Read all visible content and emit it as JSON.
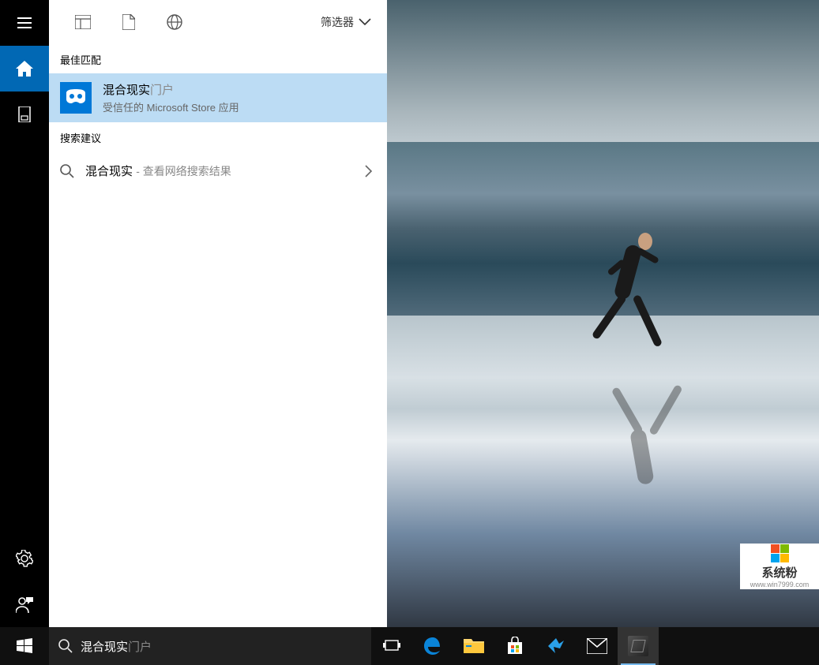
{
  "cortana": {
    "top": {
      "filter_label": "筛选器",
      "icons": [
        "apps-icon",
        "document-icon",
        "web-icon"
      ]
    },
    "sections": {
      "best_match": "最佳匹配",
      "suggestions": "搜索建议"
    },
    "best_result": {
      "title_match": "混合现实",
      "title_suffix": "门户",
      "subtitle": "受信任的 Microsoft Store 应用",
      "icon": "mixed-reality-portal-icon"
    },
    "suggestion": {
      "text": "混合现实",
      "extra": "查看网络搜索结果"
    },
    "rail": {
      "items": [
        "menu",
        "home",
        "notebook"
      ],
      "bottom_items": [
        "settings",
        "feedback"
      ]
    }
  },
  "search": {
    "typed": "混合现实",
    "completion": "门户"
  },
  "taskbar": {
    "pinned": [
      "task-view",
      "edge",
      "file-explorer",
      "store",
      "thunder",
      "mail"
    ],
    "tray": [
      "graphics-app"
    ]
  },
  "watermark": {
    "text": "系统粉",
    "url": "www.win7999.com"
  },
  "colors": {
    "accent": "#0168b4",
    "selection": "#bcdcf4",
    "taskbar": "#101010"
  }
}
